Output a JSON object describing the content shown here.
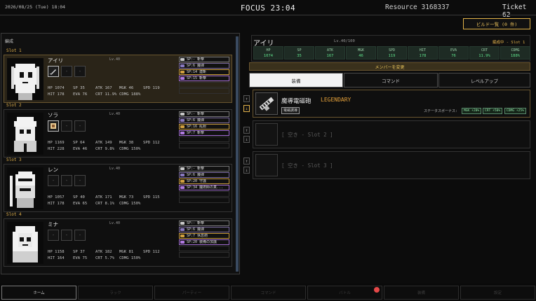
{
  "header": {
    "datetime": "2026/08/25 (Tue) 18:04",
    "focus": "FOCUS 23:04",
    "resource": "Resource 3168337",
    "ticket": "Ticket 62",
    "build_list_button": "ビルド一覧 (0 件)"
  },
  "formation": {
    "title": "編成",
    "slots": [
      {
        "header": "Slot 1",
        "name": "アイリ",
        "level": "Lv.40",
        "weapons": [
          "sword",
          "-",
          "-"
        ],
        "hp": "HP 1074",
        "sp": "SP 35",
        "atk": "ATK 167",
        "mgk": "MGK 46",
        "spd": "SPD 119",
        "hit": "HIT 178",
        "eva": "EVA 76",
        "crt": "CRT 11.9%",
        "cdmg": "CDMG 188%",
        "skills": [
          "SP:- 斬撃",
          "SP:6 魔弾",
          "SP:14 連斬",
          "SP:15 斬撃"
        ]
      },
      {
        "header": "Slot 2",
        "name": "ソラ",
        "level": "Lv.40",
        "weapons": [
          "orb",
          "-",
          "-"
        ],
        "hp": "HP 1169",
        "sp": "SP 64",
        "atk": "ATK 149",
        "mgk": "MGK 38",
        "spd": "SPD 112",
        "hit": "HIT 228",
        "eva": "EVA 46",
        "crt": "CRT 9.8%",
        "cdmg": "CDMG 150%",
        "skills": [
          "SP:- 斬撃",
          "SP:6 魔弾",
          "SP:16 乱射",
          "SP:7 斬撃"
        ]
      },
      {
        "header": "Slot 3",
        "name": "レン",
        "level": "Lv.40",
        "weapons": [
          "-",
          "-",
          "-"
        ],
        "hp": "HP 1057",
        "sp": "SP 40",
        "atk": "ATK 171",
        "mgk": "MGK 73",
        "spd": "SPD 115",
        "hit": "HIT 178",
        "eva": "EVA 65",
        "crt": "CRT 8.1%",
        "cdmg": "CDMG 150%",
        "skills": [
          "SP:- 斬撃",
          "SP:6 魔弾",
          "SP:20 守護",
          "SP:34 魔術師の真..."
        ]
      },
      {
        "header": "Slot 4",
        "name": "ミナ",
        "level": "Lv.40",
        "weapons": [
          "-",
          "-",
          "-"
        ],
        "hp": "HP 1158",
        "sp": "SP 37",
        "atk": "ATK 182",
        "mgk": "MGK 81",
        "spd": "SPD 112",
        "hit": "HIT 164",
        "eva": "EVA 75",
        "crt": "CRT 5.7%",
        "cdmg": "CDMG 150%",
        "skills": [
          "SP:- 斬撃",
          "SP:6 魔弾",
          "SP:7 休息術",
          "SP:20 装備の加護"
        ]
      }
    ]
  },
  "detail": {
    "name": "アイリ",
    "level": "Lv.40/100",
    "status": "編成中 - Slot 1",
    "stats": [
      {
        "label": "HP",
        "value": "1074"
      },
      {
        "label": "SP",
        "value": "35"
      },
      {
        "label": "ATK",
        "value": "167"
      },
      {
        "label": "MGK",
        "value": "46"
      },
      {
        "label": "SPD",
        "value": "119"
      },
      {
        "label": "HIT",
        "value": "178"
      },
      {
        "label": "EVA",
        "value": "76"
      },
      {
        "label": "CRT",
        "value": "11.9%"
      },
      {
        "label": "CDMG",
        "value": "188%"
      }
    ],
    "change_member": "メンバーを変更",
    "tabs": [
      "装備",
      "コマンド",
      "レベルアップ"
    ],
    "equipment": [
      {
        "name": "魔導電磁砲",
        "rarity": "LEGENDARY",
        "tag": "電磁誘導",
        "bonus_label": "ステータスボーナス:",
        "bonuses": [
          "MGK +20%",
          "CRT +50%",
          "CDMG +25%"
        ]
      },
      {
        "empty": "[ 空き - Slot 2 ]"
      },
      {
        "empty": "[ 空き - Slot 3 ]"
      }
    ],
    "arrows": {
      "up": "↑",
      "down": "↓"
    }
  },
  "nav": {
    "tabs": [
      "ホーム",
      "ラック",
      "パーティー",
      "コマンド",
      "バトル",
      "装備",
      "設定"
    ],
    "active_index": 0
  },
  "colors": {
    "accent": "#e0b04a",
    "legendary": "#e6a23a",
    "stat_green": "#5fe08a",
    "notification": "#e54848"
  }
}
